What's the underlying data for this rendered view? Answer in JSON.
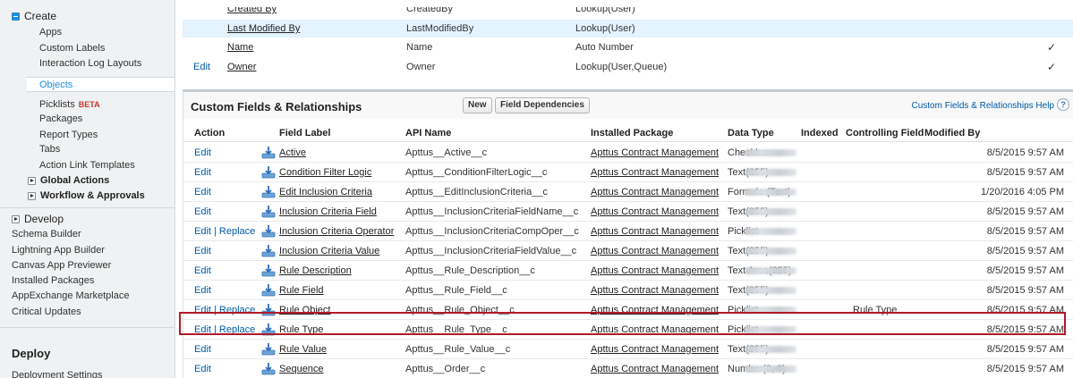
{
  "sidebar": {
    "create_label": "Create",
    "create_items": [
      "Apps",
      "Custom Labels",
      "Interaction Log Layouts"
    ],
    "selected_item": "Objects",
    "picklists_label": "Picklists",
    "beta_badge": "BETA",
    "more_items": [
      "Packages",
      "Report Types",
      "Tabs",
      "Action Link Templates"
    ],
    "global_actions": "Global Actions",
    "workflow": "Workflow & Approvals",
    "develop_label": "Develop",
    "develop_items": [
      "Schema Builder",
      "Lightning App Builder",
      "Canvas App Previewer",
      "Installed Packages",
      "AppExchange Marketplace",
      "Critical Updates"
    ],
    "deploy_label": "Deploy",
    "deploy_items": [
      "Deployment Settings"
    ]
  },
  "standard_fields": [
    {
      "action": "",
      "label": "Created By",
      "api": "CreatedBy",
      "type": "Lookup(User)",
      "indexed": false
    },
    {
      "action": "",
      "label": "Last Modified By",
      "api": "LastModifiedBy",
      "type": "Lookup(User)",
      "indexed": false
    },
    {
      "action": "",
      "label": "Name",
      "api": "Name",
      "type": "Auto Number",
      "indexed": true
    },
    {
      "action": "Edit",
      "label": "Owner",
      "api": "Owner",
      "type": "Lookup(User,Queue)",
      "indexed": true
    }
  ],
  "custom_panel": {
    "title": "Custom Fields & Relationships",
    "new_button": "New",
    "deps_button": "Field Dependencies",
    "help_link": "Custom Fields & Relationships Help",
    "help_icon": "?",
    "columns": [
      "Action",
      "Field Label",
      "API Name",
      "Installed Package",
      "Data Type",
      "Indexed",
      "Controlling Field",
      "Modified By"
    ],
    "rows": [
      {
        "action": "Edit",
        "label": "Active",
        "api": "Apttus__Active__c",
        "pkg": "Apttus Contract Management",
        "type": "Checkbox",
        "ctrl": "",
        "date": "8/5/2015 9:57 AM"
      },
      {
        "action": "Edit",
        "label": "Condition Filter Logic",
        "api": "Apttus__ConditionFilterLogic__c",
        "pkg": "Apttus Contract Management",
        "type": "Text(255)",
        "ctrl": "",
        "date": "8/5/2015 9:57 AM"
      },
      {
        "action": "Edit",
        "label": "Edit Inclusion Criteria",
        "api": "Apttus__EditInclusionCriteria__c",
        "pkg": "Apttus Contract Management",
        "type": "Formula (Text)",
        "ctrl": "",
        "date": "1/20/2016 4:05 PM"
      },
      {
        "action": "Edit",
        "label": "Inclusion Criteria Field",
        "api": "Apttus__InclusionCriteriaFieldName__c",
        "pkg": "Apttus Contract Management",
        "type": "Text(255)",
        "ctrl": "",
        "date": "8/5/2015 9:57 AM"
      },
      {
        "action": "Edit | Replace",
        "label": "Inclusion Criteria Operator",
        "api": "Apttus__InclusionCriteriaCompOper__c",
        "pkg": "Apttus Contract Management",
        "type": "Picklist",
        "ctrl": "",
        "date": "8/5/2015 9:57 AM"
      },
      {
        "action": "Edit",
        "label": "Inclusion Criteria Value",
        "api": "Apttus__InclusionCriteriaFieldValue__c",
        "pkg": "Apttus Contract Management",
        "type": "Text(255)",
        "ctrl": "",
        "date": "8/5/2015 9:57 AM"
      },
      {
        "action": "Edit",
        "label": "Rule Description",
        "api": "Apttus__Rule_Description__c",
        "pkg": "Apttus Contract Management",
        "type": "Text Area(255)",
        "ctrl": "",
        "date": "8/5/2015 9:57 AM"
      },
      {
        "action": "Edit",
        "label": "Rule Field",
        "api": "Apttus__Rule_Field__c",
        "pkg": "Apttus Contract Management",
        "type": "Text(255)",
        "ctrl": "",
        "date": "8/5/2015 9:57 AM"
      },
      {
        "action": "Edit | Replace",
        "label": "Rule Object",
        "api": "Apttus__Rule_Object__c",
        "pkg": "Apttus Contract Management",
        "type": "Picklist",
        "ctrl": "Rule Type",
        "date": "8/5/2015 9:57 AM"
      },
      {
        "action": "Edit | Replace",
        "label": "Rule Type",
        "api": "Apttus__Rule_Type__c",
        "pkg": "Apttus Contract Management",
        "type": "Picklist",
        "ctrl": "",
        "date": "8/5/2015 9:57 AM"
      },
      {
        "action": "Edit",
        "label": "Rule Value",
        "api": "Apttus__Rule_Value__c",
        "pkg": "Apttus Contract Management",
        "type": "Text(255)",
        "ctrl": "",
        "date": "8/5/2015 9:57 AM"
      },
      {
        "action": "Edit",
        "label": "Sequence",
        "api": "Apttus__Order__c",
        "pkg": "Apttus Contract Management",
        "type": "Number(2, 0)",
        "ctrl": "",
        "date": "8/5/2015 9:57 AM"
      }
    ]
  },
  "highlighted_row": "Rule Type",
  "colors": {
    "link": "#015ba7",
    "accent": "#1f8dd6",
    "highlight": "#b0192a",
    "beta": "#c23934"
  },
  "icons": {
    "create_toggle": "collapse-square-icon",
    "install": "installed-package-icon",
    "help": "help-icon"
  }
}
